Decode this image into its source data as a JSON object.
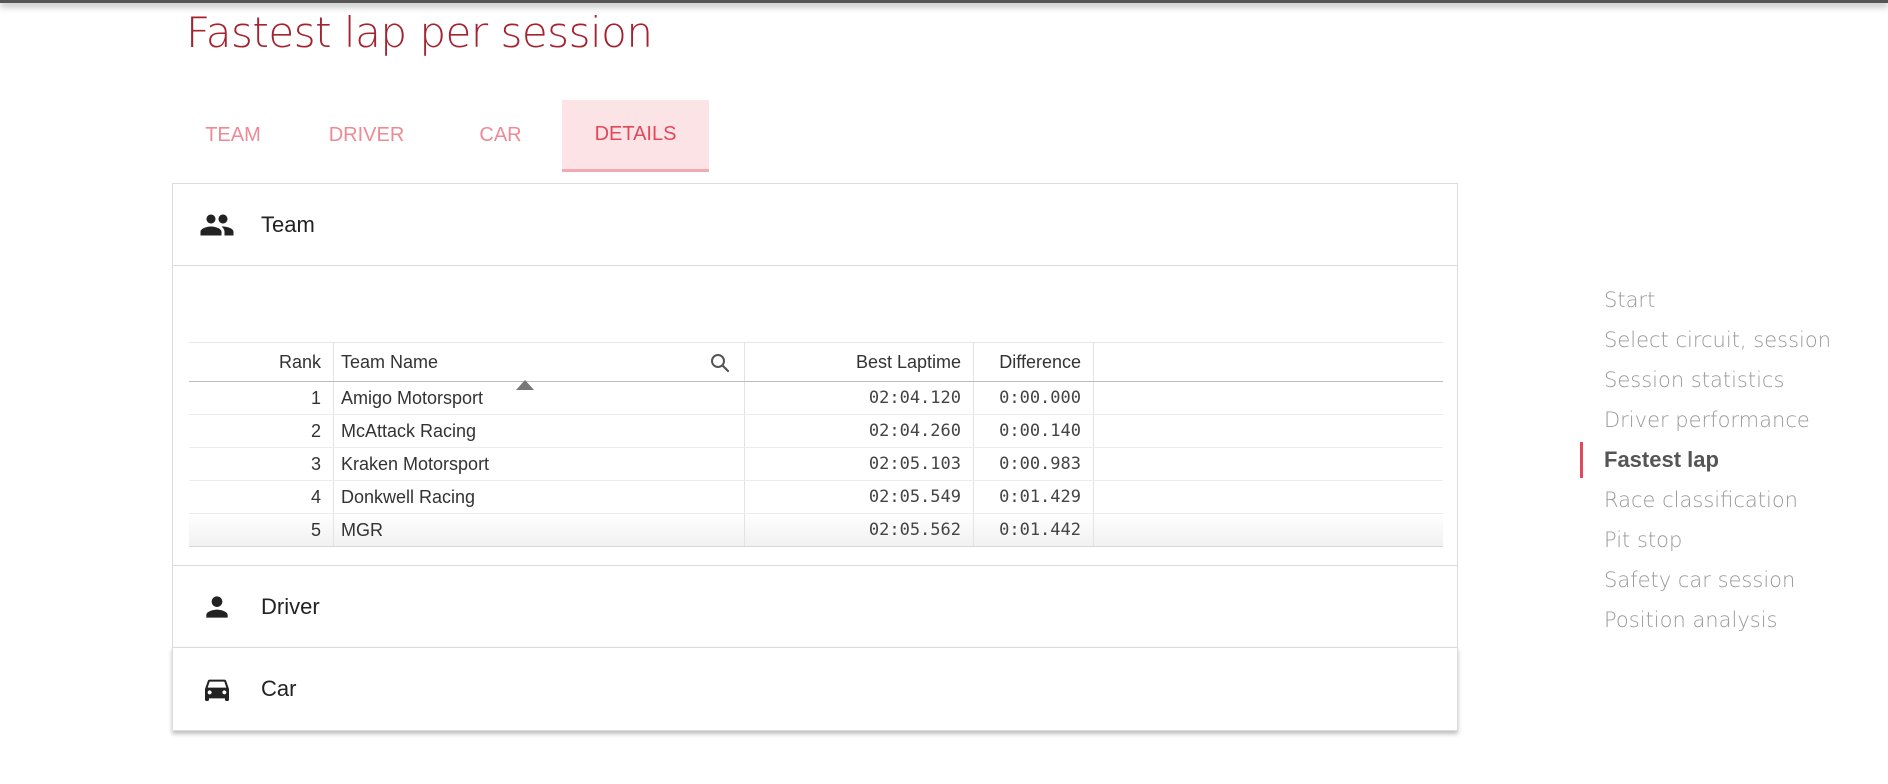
{
  "page": {
    "title": "Fastest lap per session"
  },
  "tabs": [
    {
      "label": "TEAM",
      "active": false
    },
    {
      "label": "DRIVER",
      "active": false
    },
    {
      "label": "CAR",
      "active": false
    },
    {
      "label": "DETAILS",
      "active": true
    }
  ],
  "panels": {
    "team": {
      "label": "Team",
      "icon": "group-icon",
      "expanded": true
    },
    "driver": {
      "label": "Driver",
      "icon": "person-icon",
      "expanded": false
    },
    "car": {
      "label": "Car",
      "icon": "car-icon",
      "expanded": false
    }
  },
  "table": {
    "columns": {
      "rank": "Rank",
      "team_name": "Team Name",
      "best_laptime": "Best Laptime",
      "difference": "Difference"
    },
    "sort": {
      "column": "team_name",
      "direction": "ascending",
      "icon": "sort-up-icon"
    },
    "search_icon": "search-icon",
    "rows": [
      {
        "rank": "1",
        "team_name": "Amigo Motorsport",
        "best_laptime": "02:04.120",
        "difference": "0:00.000"
      },
      {
        "rank": "2",
        "team_name": "McAttack Racing",
        "best_laptime": "02:04.260",
        "difference": "0:00.140"
      },
      {
        "rank": "3",
        "team_name": "Kraken Motorsport",
        "best_laptime": "02:05.103",
        "difference": "0:00.983"
      },
      {
        "rank": "4",
        "team_name": "Donkwell Racing",
        "best_laptime": "02:05.549",
        "difference": "0:01.429"
      },
      {
        "rank": "5",
        "team_name": "MGR",
        "best_laptime": "02:05.562",
        "difference": "0:01.442"
      }
    ]
  },
  "side_nav": {
    "items": [
      {
        "label": "Start",
        "active": false
      },
      {
        "label": "Select circuit, session",
        "active": false
      },
      {
        "label": "Session statistics",
        "active": false
      },
      {
        "label": "Driver performance",
        "active": false
      },
      {
        "label": "Fastest lap",
        "active": true
      },
      {
        "label": "Race classification",
        "active": false
      },
      {
        "label": "Pit stop",
        "active": false
      },
      {
        "label": "Safety car session",
        "active": false
      },
      {
        "label": "Position analysis",
        "active": false
      }
    ]
  },
  "colors": {
    "title": "#a4232f",
    "tab_text": "#ee8a95",
    "tab_active_bg": "#fce4e6",
    "tab_active_text": "#e2475a",
    "accent": "#e2475a"
  }
}
